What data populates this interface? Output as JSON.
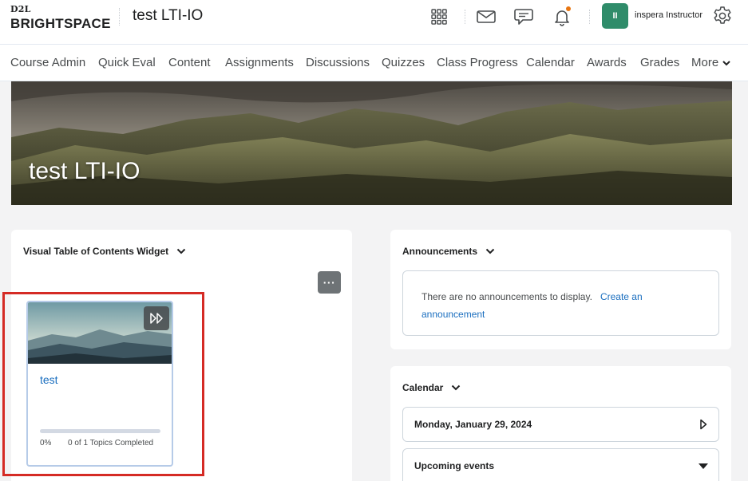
{
  "header": {
    "logo_line1": "D2L",
    "logo_line2": "BRIGHTSPACE",
    "course_title": "test LTI-IO",
    "user_initials": "II",
    "user_name": "inspera Instructor",
    "icons": [
      "apps-grid-icon",
      "mail-icon",
      "chat-icon",
      "bell-icon",
      "gear-icon"
    ],
    "notification_color": "#e87511",
    "avatar_color": "#2f8c6a"
  },
  "nav": {
    "items": [
      "Course Admin",
      "Quick Eval",
      "Content",
      "Assignments",
      "Discussions",
      "Quizzes",
      "Class Progress",
      "Calendar",
      "Awards",
      "Grades"
    ],
    "more_label": "More"
  },
  "banner": {
    "title": "test LTI-IO"
  },
  "toc_widget": {
    "title": "Visual Table of Contents Widget",
    "more_label": "···",
    "card": {
      "name": "test",
      "progress_fraction": 0,
      "progress_percent": "0%",
      "progress_text": "0 of 1 Topics Completed"
    },
    "highlight_color": "#d52b25"
  },
  "announcements": {
    "title": "Announcements",
    "empty_text": "There are no announcements to display.",
    "create_link": "Create an announcement"
  },
  "calendar": {
    "title": "Calendar",
    "date": "Monday, January 29, 2024",
    "upcoming": "Upcoming events"
  },
  "colors": {
    "link": "#1a6ebf",
    "page_bg": "#f3f3f4"
  }
}
